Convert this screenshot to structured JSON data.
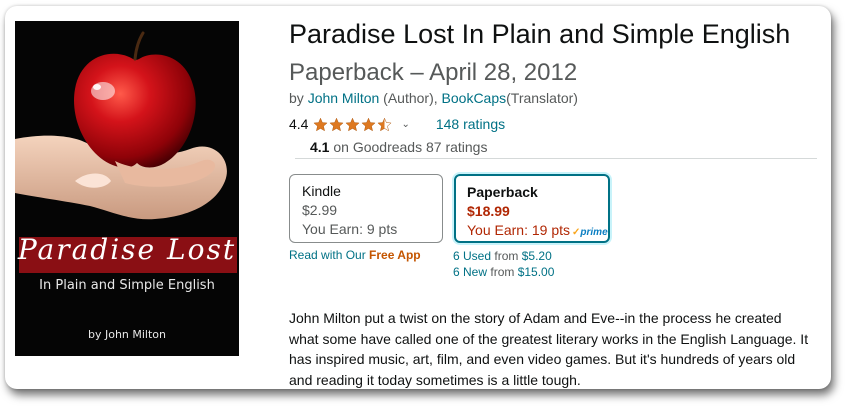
{
  "product": {
    "title": "Paradise Lost In Plain and Simple English",
    "format_date": "Paperback – April 28, 2012"
  },
  "byline": {
    "by": "by",
    "author": "John Milton",
    "author_role": "(Author),",
    "translator": "BookCaps",
    "translator_role": "(Translator)"
  },
  "rating": {
    "value": "4.4",
    "stars": 4.4,
    "count_label": "148 ratings",
    "star_color": "#de7921"
  },
  "goodreads": {
    "score": "4.1",
    "source": "on Goodreads",
    "count": "87 ratings"
  },
  "formats": {
    "kindle": {
      "name": "Kindle",
      "price": "$2.99",
      "earn": "You Earn: 9 pts"
    },
    "paperback": {
      "name": "Paperback",
      "price": "$18.99",
      "earn": "You Earn: 19 pts",
      "prime": "prime",
      "prime_check": "✓"
    }
  },
  "free_app": {
    "prefix": "Read with Our",
    "link": "Free App"
  },
  "offers": {
    "used_link": "6 Used",
    "used_from": "from",
    "used_price": "$5.20",
    "new_link": "6 New",
    "new_from": "from",
    "new_price": "$15.00"
  },
  "cover": {
    "title": "Paradise Lost",
    "subtitle": "In Plain and Simple English",
    "author": "by John Milton"
  },
  "description": "John Milton put a twist on the story of Adam and Eve--in the process he created what some have called one of the greatest literary works in the English Language. It has inspired music, art, film, and even video games. But it's hundreds of years old and reading it today sometimes is a little tough.",
  "colors": {
    "link": "#007185",
    "price": "#b12704",
    "accent": "#c45500",
    "selected_border": "#007185"
  }
}
